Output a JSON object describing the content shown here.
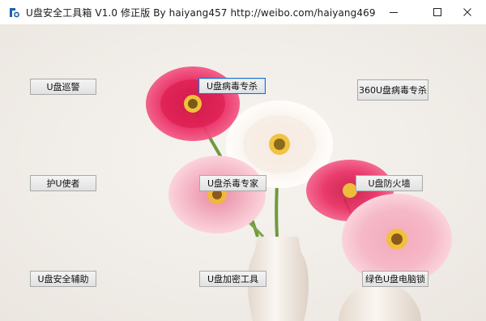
{
  "window": {
    "title": "U盘安全工具箱 V1.0 修正版   By haiyang457    http://weibo.com/haiyang469",
    "icon": "usb-app-icon",
    "controls": {
      "minimize": "minimize-icon",
      "maximize": "maximize-icon",
      "close": "close-icon"
    }
  },
  "buttons": {
    "patrol": "U盘巡警",
    "virus_killer": "U盘病毒专杀",
    "virus_360": "360U盘病毒专杀",
    "guardian": "护U使者",
    "antivirus_expert": "U盘杀毒专家",
    "firewall": "U盘防火墙",
    "safety_assist": "U盘安全辅助",
    "encrypt_tool": "U盘加密工具",
    "pc_lock": "绿色U盘电脑锁"
  },
  "colors": {
    "background": "#f1eeea",
    "focus_border": "#1c6fc9",
    "flower_red": "#e8245e",
    "flower_pink": "#f3a6b8",
    "flower_white": "#fbf6f2",
    "vase": "#efe7df"
  }
}
